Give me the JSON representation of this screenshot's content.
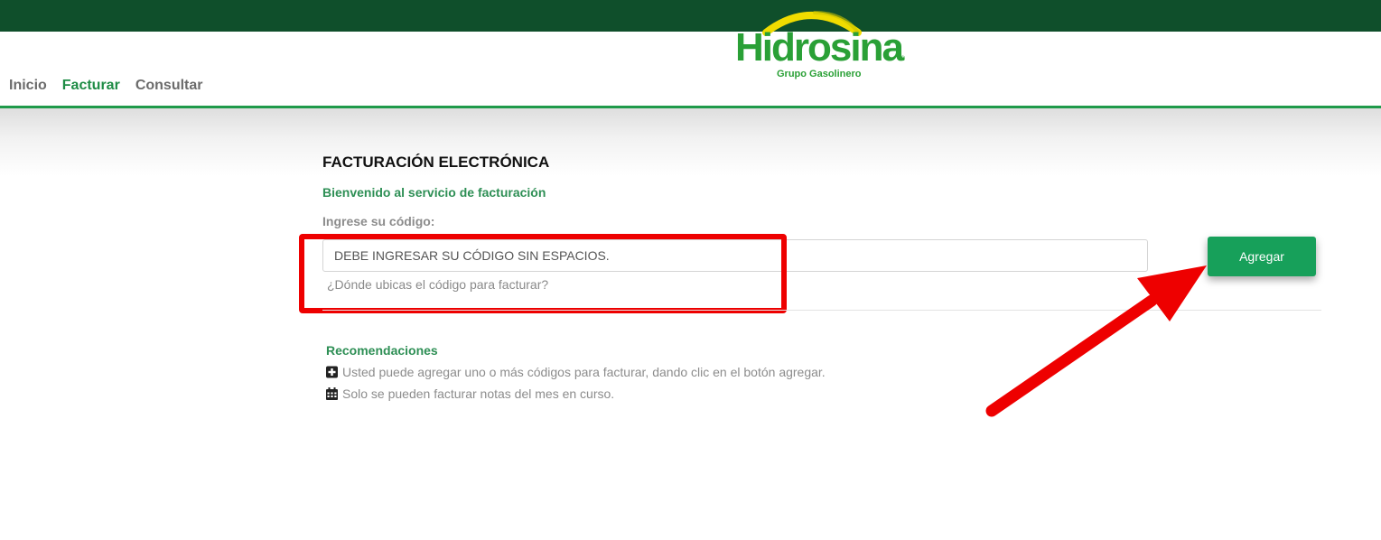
{
  "brand": {
    "name": "Hidrosina",
    "registered_mark": "®",
    "tagline": "Grupo Gasolinero",
    "primary_color": "#1f9a4a",
    "dark_color": "#0f4f2b",
    "arc_color": "#f0dc00"
  },
  "nav": {
    "items": [
      {
        "label": "Inicio",
        "active": false
      },
      {
        "label": "Facturar",
        "active": true
      },
      {
        "label": "Consultar",
        "active": false
      }
    ]
  },
  "main": {
    "title": "FACTURACIÓN ELECTRÓNICA",
    "welcome": "Bienvenido al servicio de facturación",
    "code_label": "Ingrese su código:",
    "code_input": {
      "value": "",
      "placeholder": "DEBE INGRESAR SU CÓDIGO SIN ESPACIOS."
    },
    "help_link": "¿Dónde ubicas el código para facturar?",
    "add_button": "Agregar"
  },
  "recommendations": {
    "title": "Recomendaciones",
    "items": [
      {
        "icon": "plus-square-icon",
        "text": "Usted puede agregar uno o más códigos para facturar, dando clic en el botón agregar."
      },
      {
        "icon": "calendar-icon",
        "text": "Solo se pueden facturar notas del mes en curso."
      }
    ]
  },
  "annotations": {
    "highlight_color": "#ee0000"
  }
}
